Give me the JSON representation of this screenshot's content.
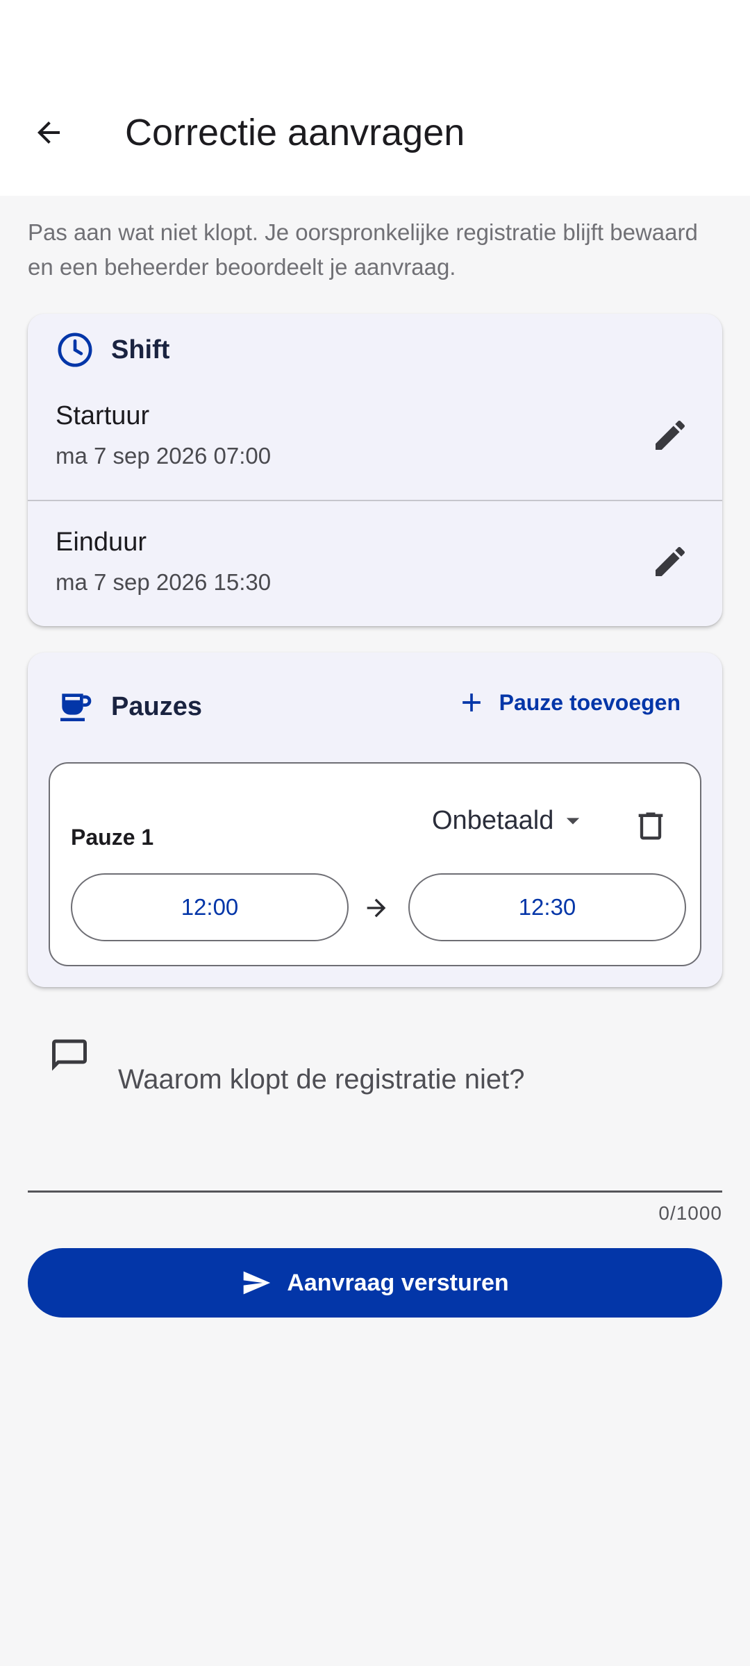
{
  "app_bar": {
    "title": "Correctie aanvragen",
    "back_icon": "arrow-back-icon"
  },
  "intro_text": "Pas aan wat niet klopt. Je oorspronkelijke registratie blijft bewaard en een beheerder beoordeelt je aanvraag.",
  "shift": {
    "title": "Shift",
    "icon": "clock-icon",
    "start": {
      "label": "Startuur",
      "value": "ma 7 sep 2026 07:00"
    },
    "end": {
      "label": "Einduur",
      "value": "ma 7 sep 2026 15:30"
    }
  },
  "breaks": {
    "title": "Pauzes",
    "icon": "coffee-cup-icon",
    "add_label": "Pauze toevoegen",
    "items": [
      {
        "title": "Pauze 1",
        "type": "Onbetaald",
        "start": "12:00",
        "end": "12:30"
      }
    ]
  },
  "comment": {
    "placeholder": "Waarom klopt de registratie niet?",
    "counter": "0/1000"
  },
  "submit": {
    "label": "Aanvraag versturen"
  },
  "colors": {
    "primary": "#0336a8",
    "card_background": "#f2f2fa",
    "page_background": "#f6f6f7"
  }
}
